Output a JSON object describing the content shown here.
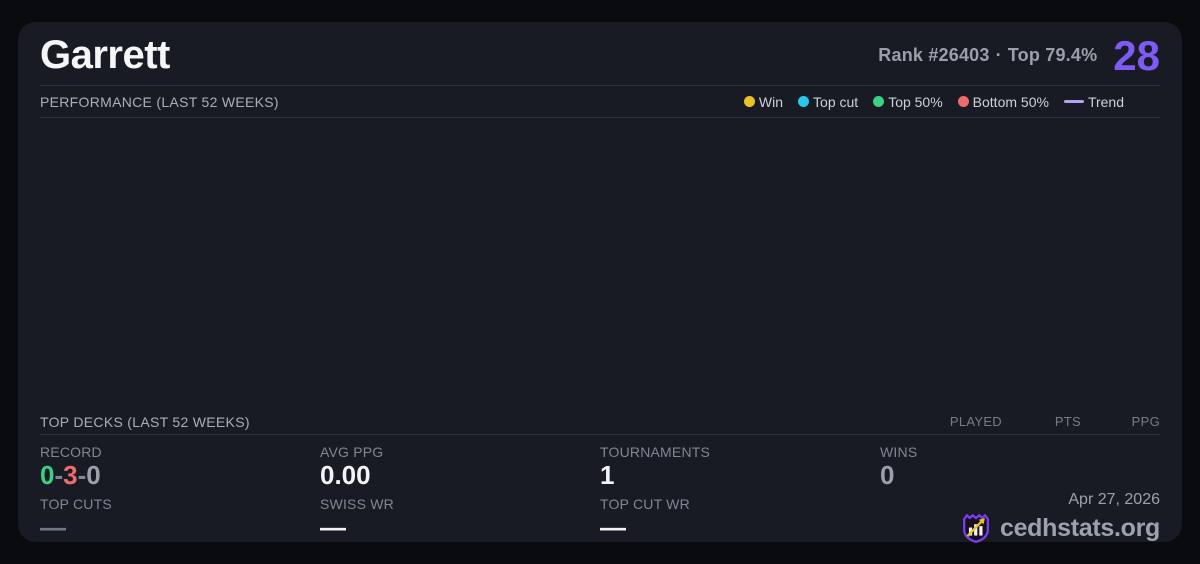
{
  "card": {
    "player_name": "Garrett",
    "rank_label": "Rank #26403",
    "rank_separator": "·",
    "top_percent": "Top 79.4%",
    "score": "28",
    "accent_color": "#7e5bf5",
    "background_color": "#191b24"
  },
  "performance": {
    "title": "PERFORMANCE (LAST 52 WEEKS)",
    "legend": [
      {
        "label": "Win",
        "color": "#e9c228",
        "marker": "dot"
      },
      {
        "label": "Top cut",
        "color": "#27c8e8",
        "marker": "dot"
      },
      {
        "label": "Top 50%",
        "color": "#3bd183",
        "marker": "dot"
      },
      {
        "label": "Bottom 50%",
        "color": "#ef6c6c",
        "marker": "dot"
      },
      {
        "label": "Trend",
        "color": "#b5a0f2",
        "marker": "line"
      }
    ]
  },
  "top_decks": {
    "title": "TOP DECKS (LAST 52 WEEKS)",
    "columns": [
      "PLAYED",
      "PTS",
      "PPG"
    ],
    "rows": []
  },
  "stats": {
    "record": {
      "label": "RECORD",
      "wins": "0",
      "losses": "3",
      "draws": "0",
      "separator": "-",
      "wins_color": "#3bd183",
      "losses_color": "#ef6c6c",
      "draws_color": "#9aa1ad"
    },
    "avg_ppg": {
      "label": "AVG PPG",
      "value": "0.00"
    },
    "tournaments": {
      "label": "TOURNAMENTS",
      "value": "1"
    },
    "wins": {
      "label": "WINS",
      "value": "0"
    },
    "top_cuts": {
      "label": "TOP CUTS",
      "value": "—"
    },
    "swiss_wr": {
      "label": "SWISS WR",
      "value": "—"
    },
    "top_cut_wr": {
      "label": "TOP CUT WR",
      "value": "—"
    }
  },
  "footer": {
    "date": "Apr 27, 2026",
    "brand": "cedhstats.org"
  }
}
